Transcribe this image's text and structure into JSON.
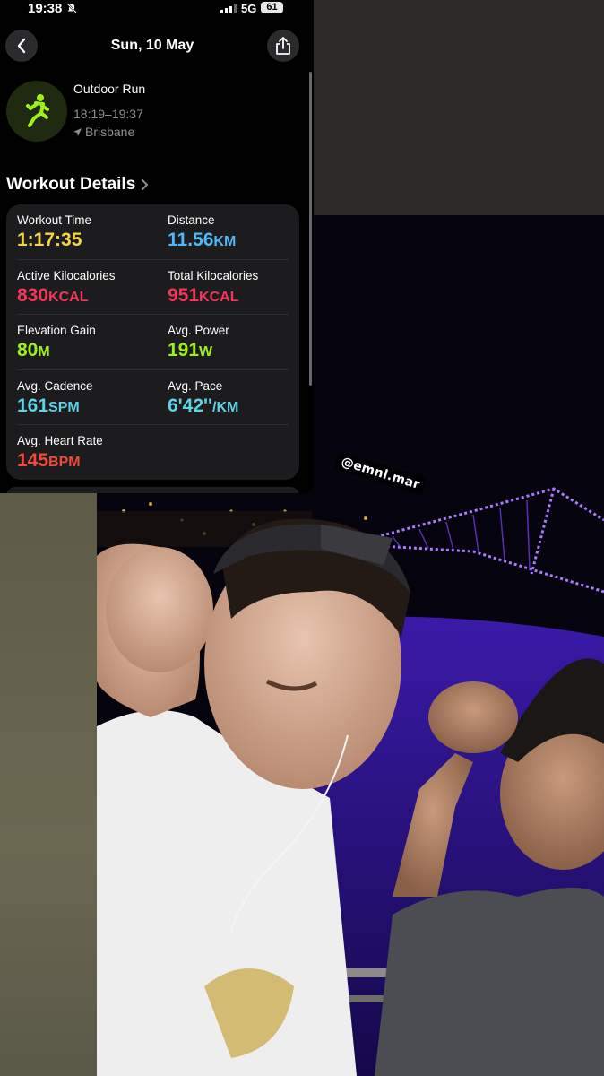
{
  "status_bar": {
    "time": "19:38",
    "network": "5G",
    "battery": "61"
  },
  "nav": {
    "title": "Sun, 10 May"
  },
  "workout": {
    "name": "Outdoor Run",
    "time_range": "18:19–19:37",
    "location": "Brisbane",
    "accent": "#9ef01a"
  },
  "section": {
    "title": "Workout Details"
  },
  "metrics": [
    {
      "label": "Workout Time",
      "value": "1:17:35",
      "unit": "",
      "color": "#f5d547"
    },
    {
      "label": "Distance",
      "value": "11.56",
      "unit": "KM",
      "color": "#4fb8f5"
    },
    {
      "label": "Active Kilocalories",
      "value": "830",
      "unit": "KCAL",
      "color": "#f2365a"
    },
    {
      "label": "Total Kilocalories",
      "value": "951",
      "unit": "KCAL",
      "color": "#f2365a"
    },
    {
      "label": "Elevation Gain",
      "value": "80",
      "unit": "M",
      "color": "#9ef01a"
    },
    {
      "label": "Avg. Power",
      "value": "191",
      "unit": "W",
      "color": "#9ef01a"
    },
    {
      "label": "Avg. Cadence",
      "value": "161",
      "unit": "SPM",
      "color": "#5ed2e6"
    },
    {
      "label": "Avg. Pace",
      "value": "6'42''",
      "unit": "/KM",
      "color": "#5ed2e6"
    },
    {
      "label": "Avg. Heart Rate",
      "value": "145",
      "unit": "BPM",
      "color": "#f24a3a"
    }
  ],
  "overlay": {
    "mention": "@emnl.mar"
  }
}
